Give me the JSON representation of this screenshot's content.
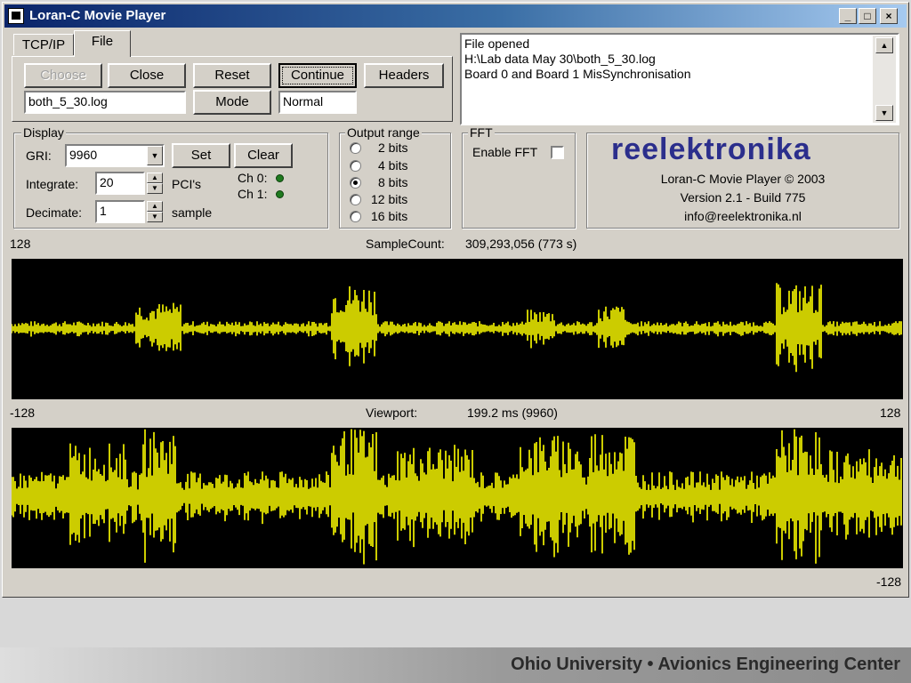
{
  "window": {
    "title": "Loran-C Movie Player",
    "minimize": "_",
    "maximize": "□",
    "close": "×"
  },
  "tabs": [
    {
      "label": "TCP/IP",
      "active": false
    },
    {
      "label": "File",
      "active": true
    }
  ],
  "file_panel": {
    "choose": "Choose",
    "close": "Close",
    "reset": "Reset",
    "continue": "Continue",
    "headers": "Headers",
    "filename": "both_5_30.log",
    "mode_button": "Mode",
    "mode_value": "Normal"
  },
  "log": {
    "lines": [
      "File opened",
      "H:\\Lab data May 30\\both_5_30.log",
      "Board 0 and Board 1 MisSynchronisation"
    ]
  },
  "display": {
    "group_label": "Display",
    "gri_label": "GRI:",
    "gri_value": "9960",
    "set": "Set",
    "clear": "Clear",
    "integrate_label": "Integrate:",
    "integrate_value": "20",
    "integrate_unit": "PCI's",
    "decimate_label": "Decimate:",
    "decimate_value": "1",
    "decimate_unit": "sample",
    "ch0": "Ch 0:",
    "ch1": "Ch 1:"
  },
  "output_range": {
    "label": "Output range",
    "options": [
      "2 bits",
      "4 bits",
      "8 bits",
      "12 bits",
      "16 bits"
    ],
    "selected": "8 bits"
  },
  "fft": {
    "label": "FFT",
    "enable": "Enable FFT"
  },
  "about": {
    "logo": "reelektronika",
    "line1": "Loran-C Movie Player © 2003",
    "line2": "Version 2.1 - Build 775",
    "line3": "info@reelektronika.nl"
  },
  "scope_top": {
    "max_label": "128",
    "count_label": "SampleCount:",
    "count_value": "309,293,056 (773 s)"
  },
  "scope_mid": {
    "min_label": "-128",
    "viewport_label": "Viewport:",
    "viewport_value": "199.2 ms (9960)",
    "max_label": "128"
  },
  "scope_bottom": {
    "min_label": "-128"
  },
  "colors": {
    "signal": "#ffff00",
    "scope_bg": "#000000",
    "led": "#1f7a1f"
  },
  "footer": "Ohio University • Avionics Engineering Center"
}
